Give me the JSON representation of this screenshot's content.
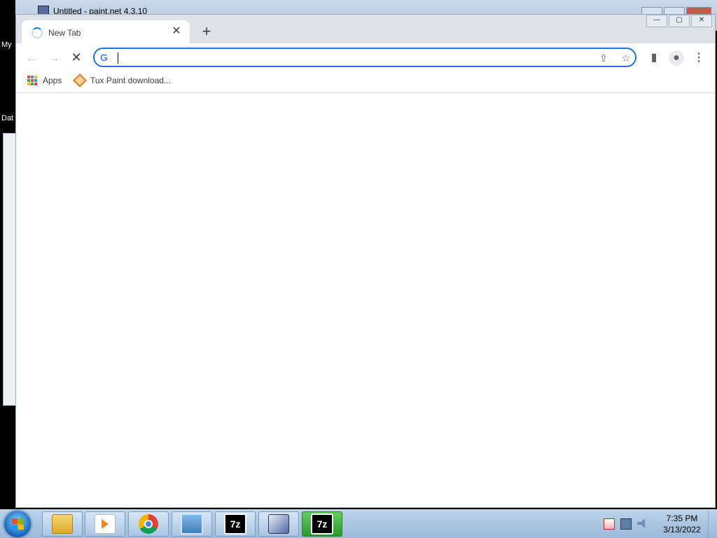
{
  "background_window": {
    "title": "Untitled - paint.net 4.3.10"
  },
  "desktop": {
    "label_top": "My",
    "label_mid": "Dat"
  },
  "chrome": {
    "tab": {
      "title": "New Tab",
      "close": "✕"
    },
    "new_tab": "+",
    "toolbar": {
      "back": "←",
      "forward": "→",
      "stop": "✕",
      "omnibox_value": "",
      "omnibox_icon": "G",
      "share": "⇪",
      "star": "☆",
      "side_panel": "▮",
      "profile": "●",
      "menu": "⋮"
    },
    "bookmarks": [
      {
        "label": "Apps",
        "icon": "apps-grid-icon"
      },
      {
        "label": "Tux Paint download...",
        "icon": "tux-paint-icon"
      }
    ],
    "window_controls": {
      "minimize": "—",
      "maximize": "▢",
      "close": "✕"
    }
  },
  "taskbar": {
    "apps": [
      {
        "name": "windows-explorer",
        "icon": "folder-icon"
      },
      {
        "name": "media-player",
        "icon": "media-player-icon"
      },
      {
        "name": "chrome",
        "icon": "chrome-icon"
      },
      {
        "name": "photo-viewer",
        "icon": "photo-viewer-icon"
      },
      {
        "name": "7zip",
        "icon": "7zip-icon",
        "text": "7z"
      },
      {
        "name": "paint-net",
        "icon": "paint-net-icon"
      },
      {
        "name": "7zip-active",
        "icon": "7zip-icon",
        "text": "7z"
      }
    ],
    "clock": {
      "time": "7:35 PM",
      "date": "3/13/2022"
    }
  },
  "colors": {
    "omnibox_border": "#1a73e8",
    "tabstrip": "#dee1e6",
    "taskbar": "#a9c4e2",
    "active_task": "#3fb13f"
  }
}
